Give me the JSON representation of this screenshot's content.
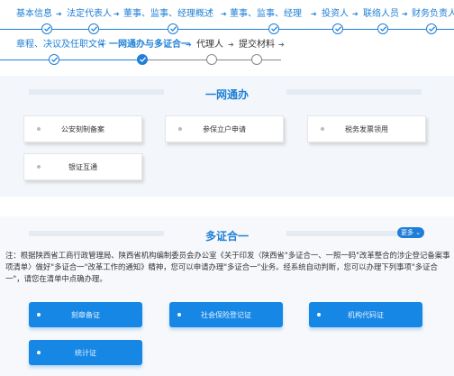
{
  "steps": [
    {
      "label": "基本信息",
      "state": "done"
    },
    {
      "label": "法定代表人",
      "state": "done"
    },
    {
      "label": "董事、监事、经理概述",
      "state": "done"
    },
    {
      "label": "董事、监事、经理",
      "state": "done"
    },
    {
      "label": "投资人",
      "state": "done"
    },
    {
      "label": "联络人员",
      "state": "done"
    },
    {
      "label": "财务负责人",
      "state": "done"
    },
    {
      "label": "章程、决议及任职文件",
      "state": "done"
    },
    {
      "label": "一网通办与多证合一",
      "state": "current"
    },
    {
      "label": "代理人",
      "state": "pending"
    },
    {
      "label": "提交材料",
      "state": "pending"
    }
  ],
  "arrow_glyph": "➔",
  "yiwang": {
    "title": "一网通办",
    "items": [
      "公安刻制备案",
      "参保立户申请",
      "税务发票领用",
      "银证互通"
    ]
  },
  "duozheng": {
    "title": "多证合一",
    "more_label": "更多",
    "note": "注：根据陕西省工商行政管理局、陕西省机构编制委员会办公室《关于印发〈陕西省\"多证合一、一照一码\"改革整合的涉企登记备案事项清单〉做好\"多证合一\"改革工作的通知》精神，您可以申请办理\"多证合一\"业务。经系统自动判断，您可以办理下列事项\"多证合一\"，请您在清单中点确办理。",
    "items": [
      "刻章备证",
      "社会保险登记证",
      "机构代码证",
      "统计证"
    ]
  },
  "colors": {
    "accent": "#1f7fd6",
    "card_blue": "#1787e6"
  }
}
